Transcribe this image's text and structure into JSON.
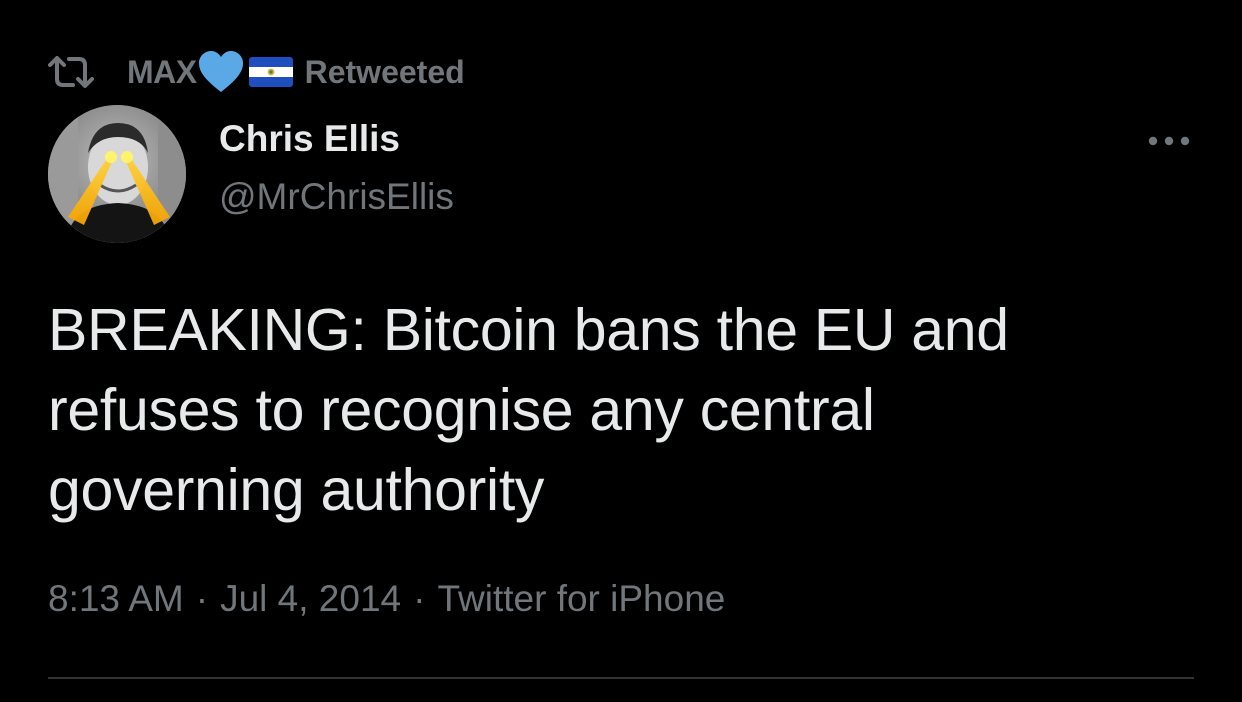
{
  "retweet_context": {
    "icon": "retweet-icon",
    "name": "MAX",
    "badge_icons": [
      "blue-heart-icon",
      "el-salvador-flag-icon"
    ],
    "label": "Retweeted"
  },
  "author": {
    "name": "Chris Ellis",
    "handle": "@MrChrisEllis",
    "avatar_icon": "profile-photo"
  },
  "tweet": {
    "lines": [
      "BREAKING: Bitcoin bans the EU and",
      "refuses to recognise any central",
      "governing authority"
    ]
  },
  "meta": {
    "time": "8:13 AM",
    "separator": "·",
    "date": "Jul 4, 2014",
    "source": "Twitter for iPhone"
  },
  "colors": {
    "background": "#000000",
    "primary_text": "#e7e9ea",
    "secondary_text": "#71767b",
    "heart": "#5aa9e6",
    "divider": "#2f3336"
  },
  "more_icon": "more-horizontal-icon"
}
